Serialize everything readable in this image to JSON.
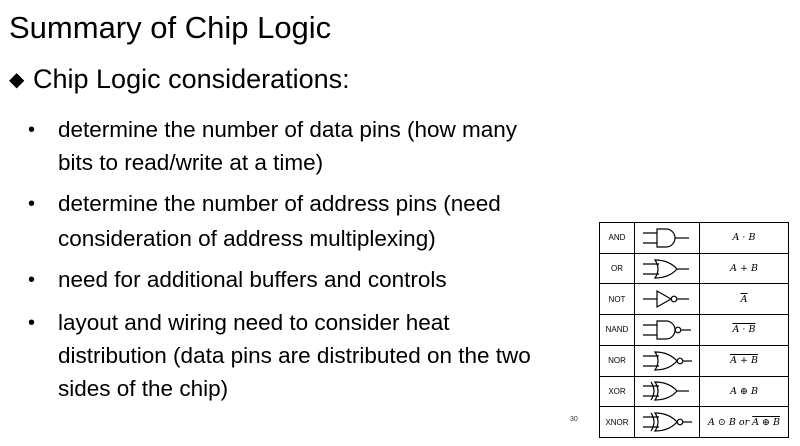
{
  "slide": {
    "title": "Summary of Chip Logic",
    "heading_marker": "◆",
    "heading": "Chip Logic considerations:",
    "bullet_marker": "•",
    "bullets": [
      [
        "determine the number of data pins (how many",
        "bits to read/write at a time)"
      ],
      [
        "determine the number of address pins (need",
        "consideration of address multiplexing)"
      ],
      [
        "need for additional buffers and controls"
      ],
      [
        "layout and wiring need to consider heat",
        "distribution (data pins are distributed on the two",
        "sides of the chip)"
      ]
    ],
    "page_number": "30"
  },
  "gate_table": {
    "rows": [
      {
        "name": "AND",
        "icon": "and-gate-icon",
        "expr": "A · B",
        "over": ""
      },
      {
        "name": "OR",
        "icon": "or-gate-icon",
        "expr": "A + B",
        "over": ""
      },
      {
        "name": "NOT",
        "icon": "not-gate-icon",
        "expr": "",
        "over": "A"
      },
      {
        "name": "NAND",
        "icon": "nand-gate-icon",
        "expr": "",
        "over": "A · B"
      },
      {
        "name": "NOR",
        "icon": "nor-gate-icon",
        "expr": "",
        "over": "A + B"
      },
      {
        "name": "XOR",
        "icon": "xor-gate-icon",
        "expr": "A ⊕ B",
        "over": ""
      },
      {
        "name": "XNOR",
        "icon": "xnor-gate-icon",
        "expr": "A ⊙ B or ",
        "over": "A ⊕ B"
      }
    ]
  }
}
